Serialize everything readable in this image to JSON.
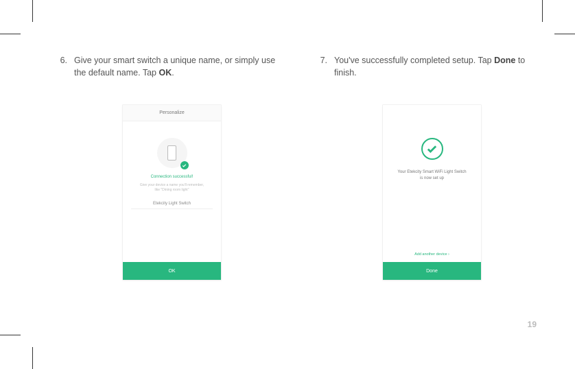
{
  "steps": {
    "six": {
      "num": "6.",
      "text_a": "Give your smart switch a unique name, or simply use the default name. Tap ",
      "text_b": "OK",
      "text_c": "."
    },
    "seven": {
      "num": "7.",
      "text_a": "You've successfully completed setup. Tap ",
      "text_b": "Done",
      "text_c": " to finish."
    }
  },
  "screen_left": {
    "header": "Personalize",
    "connection": "Connection successful!",
    "hint_1": "Give your device a name you'll remember,",
    "hint_2": "like \"Dining room light\"",
    "device_name": "Etekcity Light Switch",
    "footer": "OK"
  },
  "screen_right": {
    "success_1": "Your Etekcity Smart WiFi Light Switch",
    "success_2": "is now set up",
    "add_link": "Add another device ›",
    "footer": "Done"
  },
  "page_number": "19",
  "colors": {
    "accent": "#28b77f"
  }
}
